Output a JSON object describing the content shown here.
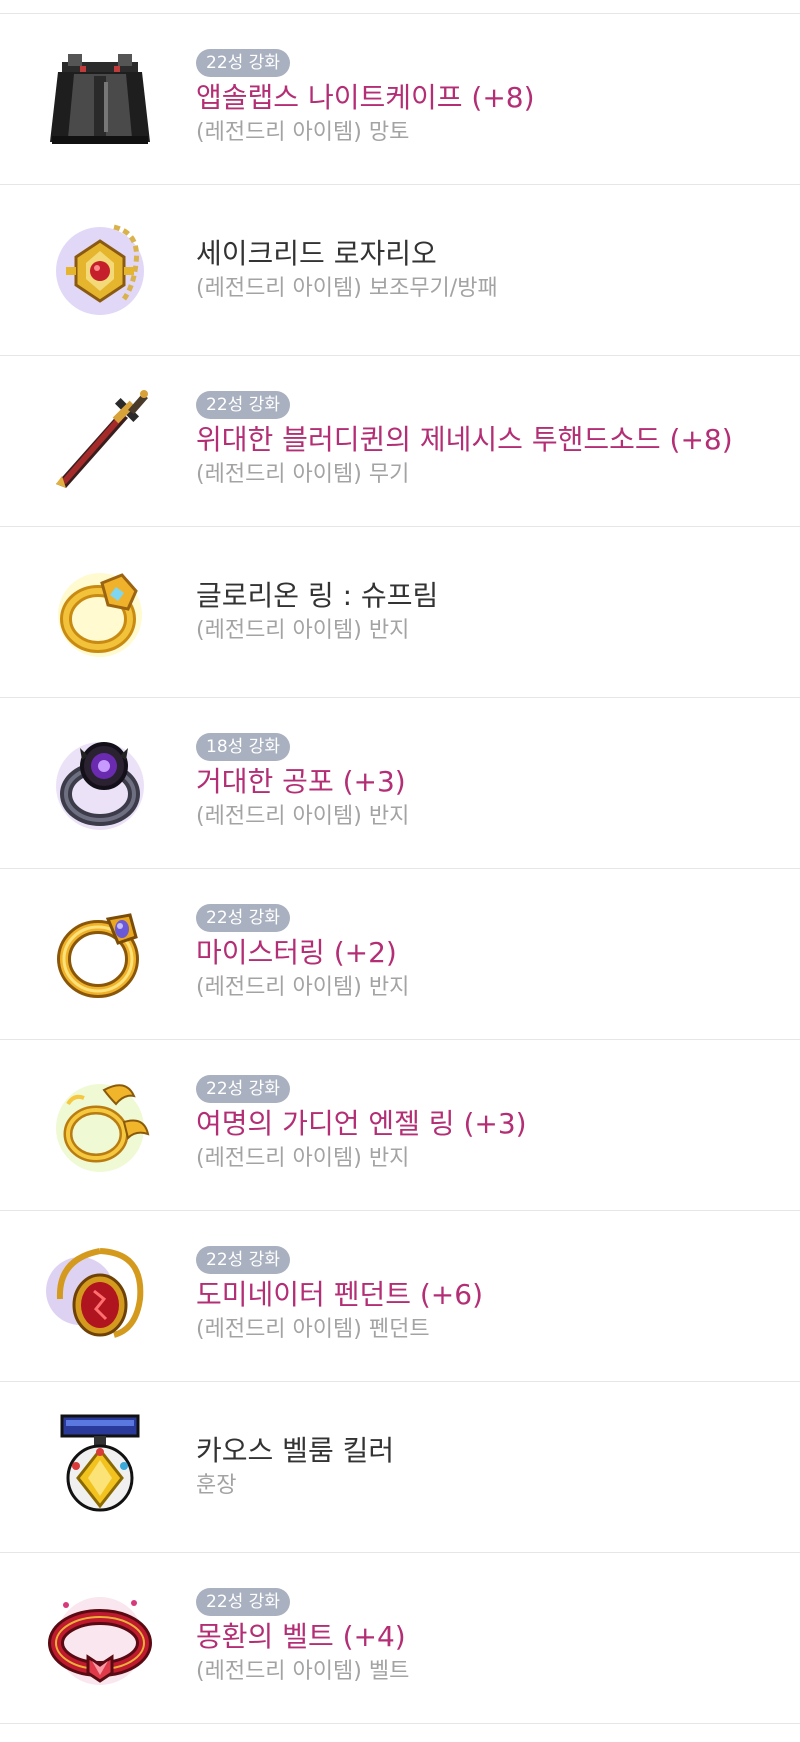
{
  "items": [
    {
      "badge": "22성 강화",
      "name": "앱솔랩스 나이트케이프 (+8)",
      "name_prefix": "",
      "category": "(레전드리 아이템) 망토",
      "icon": "cape-icon",
      "name_style": "enh"
    },
    {
      "badge": "",
      "name": "세이크리드 로자리오",
      "name_prefix": "",
      "category": "(레전드리 아이템) 보조무기/방패",
      "icon": "rosary-icon",
      "name_style": "plain"
    },
    {
      "badge": "22성 강화",
      "name": "제네시스 투핸드소드 (+8)",
      "name_prefix": "위대한 블러디퀸의 ",
      "category": "(레전드리 아이템) 무기",
      "icon": "sword-icon",
      "name_style": "enh"
    },
    {
      "badge": "",
      "name": "글로리온 링 : 슈프림",
      "name_prefix": "",
      "category": "(레전드리 아이템) 반지",
      "icon": "ring-gold-icon",
      "name_style": "plain"
    },
    {
      "badge": "18성 강화",
      "name": "거대한 공포 (+3)",
      "name_prefix": "",
      "category": "(레전드리 아이템) 반지",
      "icon": "ring-dark-icon",
      "name_style": "enh"
    },
    {
      "badge": "22성 강화",
      "name": "마이스터링 (+2)",
      "name_prefix": "",
      "category": "(레전드리 아이템) 반지",
      "icon": "ring-meister-icon",
      "name_style": "enh"
    },
    {
      "badge": "22성 강화",
      "name": "여명의 가디언 엔젤 링 (+3)",
      "name_prefix": "",
      "category": "(레전드리 아이템) 반지",
      "icon": "ring-angel-icon",
      "name_style": "enh"
    },
    {
      "badge": "22성 강화",
      "name": "도미네이터 펜던트 (+6)",
      "name_prefix": "",
      "category": "(레전드리 아이템) 펜던트",
      "icon": "pendant-icon",
      "name_style": "enh"
    },
    {
      "badge": "",
      "name": "카오스 벨룸 킬러",
      "name_prefix": "",
      "category": "훈장",
      "icon": "medal-icon",
      "name_style": "plain"
    },
    {
      "badge": "22성 강화",
      "name": "몽환의 벨트 (+4)",
      "name_prefix": "",
      "category": "(레전드리 아이템) 벨트",
      "icon": "belt-icon",
      "name_style": "enh"
    }
  ],
  "colors": {
    "enhanced_name": "#b32e74",
    "plain_name": "#333333",
    "prefix_green": "#2e7d32",
    "badge_bg": "#a9b0bf",
    "category_text": "#a3a3a3"
  }
}
